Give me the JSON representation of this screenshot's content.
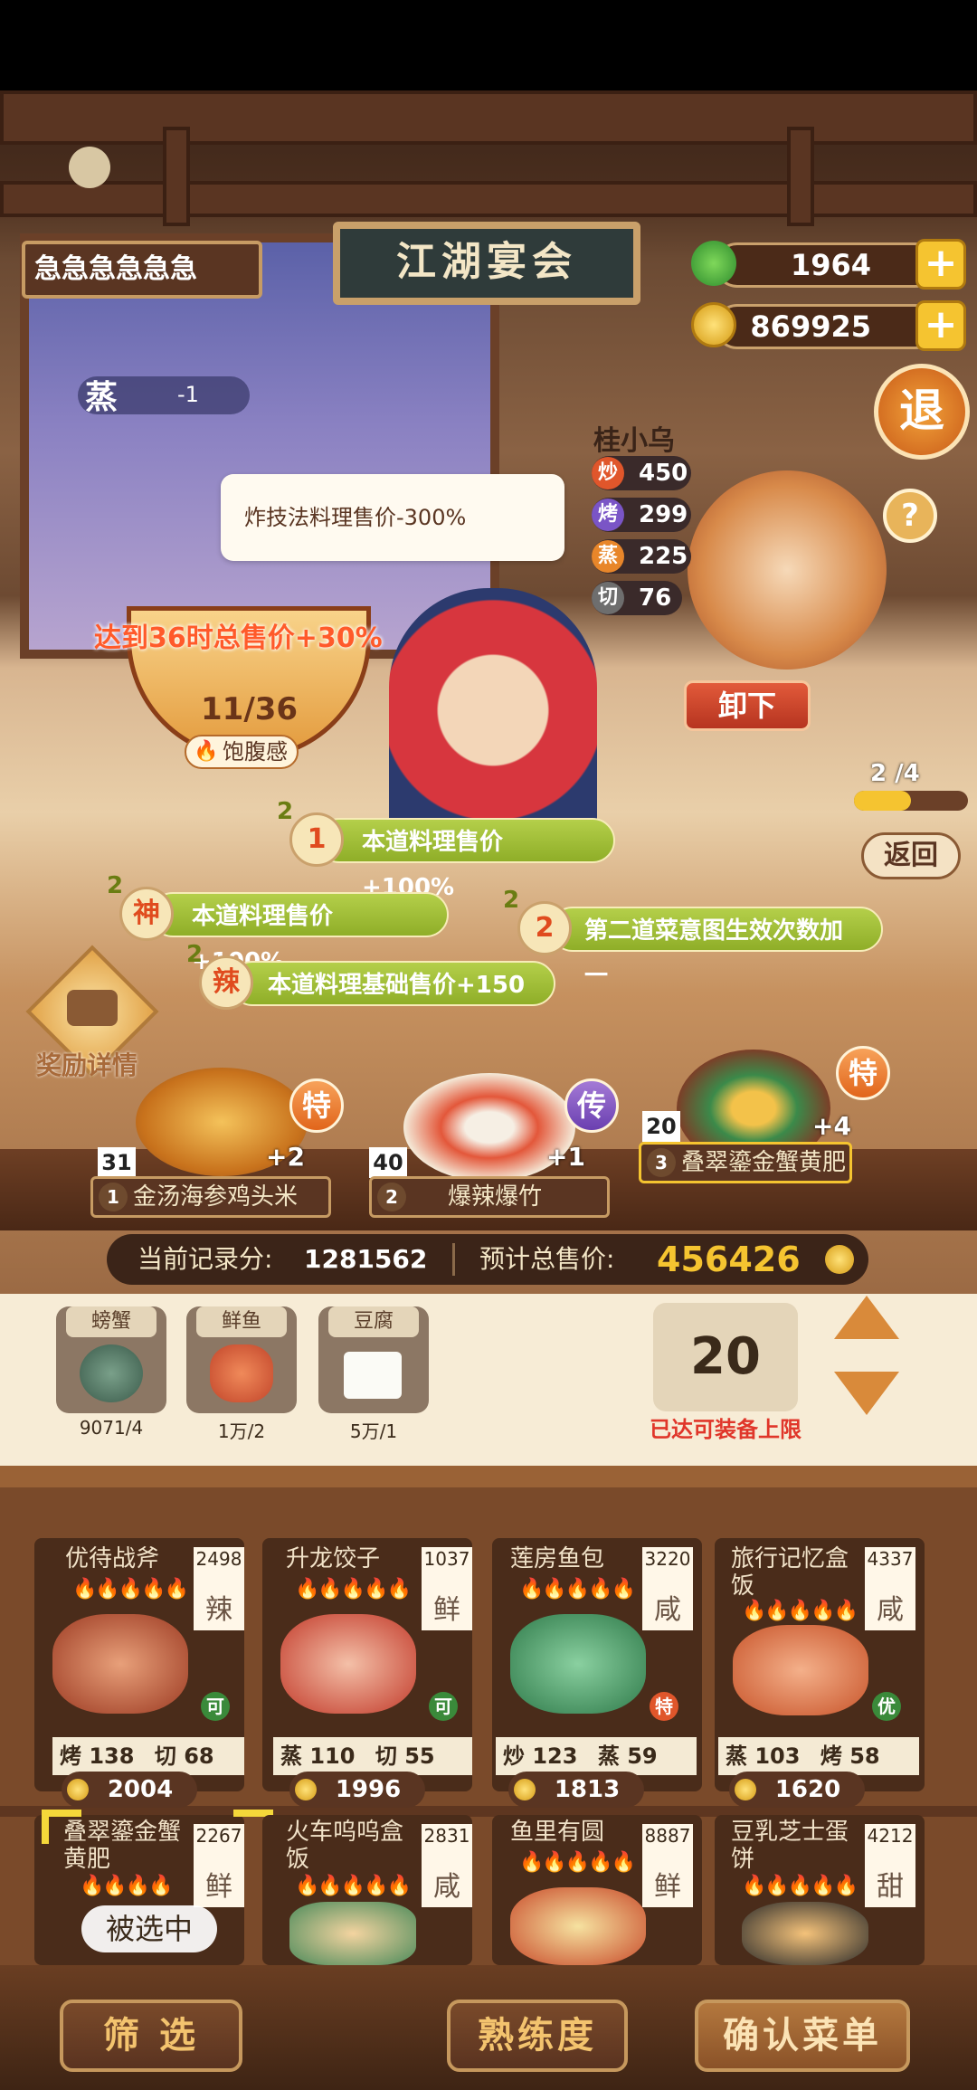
{
  "header": {
    "player_name": "急急急急急急",
    "sign_title": "江湖宴会",
    "jade": "1964",
    "coins": "869925",
    "exit_label": "退",
    "help_label": "?"
  },
  "steam_tag": {
    "label": "蒸",
    "value": "-1"
  },
  "tooltip": "炸技法料理售价-300%",
  "chef": {
    "name": "桂小乌",
    "stats": [
      {
        "key": "炒",
        "value": "450",
        "color": "#e0562b"
      },
      {
        "key": "烤",
        "value": "299",
        "color": "#7a55c6"
      },
      {
        "key": "蒸",
        "value": "225",
        "color": "#e8862a"
      },
      {
        "key": "切",
        "value": "76",
        "color": "#6e6e6e"
      }
    ],
    "unload_label": "卸下"
  },
  "satiety": {
    "goal": "达到36时总售价+30%",
    "progress": "11/36",
    "label": "饱腹感"
  },
  "page_indicator": {
    "current": "2",
    "text": "2 /4",
    "back_label": "返回"
  },
  "bonuses": [
    {
      "count": "2",
      "badge": "1",
      "text": "本道料理售价+100%"
    },
    {
      "count": "2",
      "badge": "神",
      "text": "本道料理售价+100%"
    },
    {
      "count": "2",
      "badge": "2",
      "text": "第二道菜意图生效次数加一"
    },
    {
      "count": "2",
      "badge": "辣",
      "text": "本道料理基础售价+150"
    }
  ],
  "reward_label": "奖励详情",
  "dishes": [
    {
      "num": "31",
      "index": "1",
      "name": "金汤海参鸡头米",
      "bonus": "+2",
      "tier": "特"
    },
    {
      "num": "40",
      "index": "2",
      "name": "爆辣爆竹",
      "bonus": "+1",
      "tier": "传"
    },
    {
      "num": "20",
      "index": "3",
      "name": "叠翠鎏金蟹黄肥",
      "bonus": "+4",
      "tier": "特"
    }
  ],
  "score": {
    "record_label": "当前记录分:",
    "record_value": "1281562",
    "total_label": "预计总售价:",
    "total_value": "456426"
  },
  "ingredients": [
    {
      "tag": "螃蟹",
      "count": "9071/4"
    },
    {
      "tag": "鲜鱼",
      "count": "1万/2"
    },
    {
      "tag": "豆腐",
      "count": "5万/1"
    }
  ],
  "quantity": {
    "value": "20",
    "limit_text": "已达可装备上限"
  },
  "recipes_row1": [
    {
      "name": "优待战斧",
      "value": "2498",
      "taste": "辣",
      "badge": "可",
      "stat1_k": "烤",
      "stat1_v": "138",
      "stat2_k": "切",
      "stat2_v": "68",
      "price": "2004",
      "color": "#9c3a22"
    },
    {
      "name": "升龙饺子",
      "value": "1037",
      "taste": "鲜",
      "badge": "可",
      "stat1_k": "蒸",
      "stat1_v": "110",
      "stat2_k": "切",
      "stat2_v": "55",
      "price": "1996",
      "color": "#c23a2a"
    },
    {
      "name": "莲房鱼包",
      "value": "3220",
      "taste": "咸",
      "badge": "特",
      "stat1_k": "炒",
      "stat1_v": "123",
      "stat2_k": "蒸",
      "stat2_v": "59",
      "price": "1813",
      "color": "#2f7a4a"
    },
    {
      "name": "旅行记忆盒饭",
      "value": "4337",
      "taste": "咸",
      "badge": "优",
      "stat1_k": "蒸",
      "stat1_v": "103",
      "stat2_k": "烤",
      "stat2_v": "58",
      "price": "1620",
      "color": "#c8542a"
    }
  ],
  "recipes_row2": [
    {
      "name": "叠翠鎏金蟹黄肥",
      "value": "2267",
      "taste": "鲜",
      "selected": "被选中"
    },
    {
      "name": "火车呜呜盒饭",
      "value": "2831",
      "taste": "咸",
      "selected": ""
    },
    {
      "name": "鱼里有圆",
      "value": "8887",
      "taste": "鲜",
      "selected": ""
    },
    {
      "name": "豆乳芝士蛋饼",
      "value": "4212",
      "taste": "甜",
      "selected": ""
    }
  ],
  "buttons": {
    "filter": "筛 选",
    "proficiency": "熟练度",
    "confirm": "确认菜单"
  }
}
